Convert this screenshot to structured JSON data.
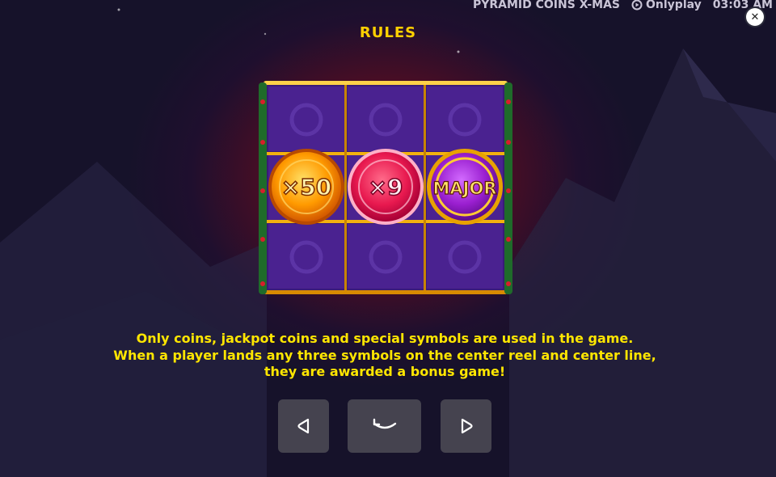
{
  "header": {
    "game_title": "PYRAMID COINS X-MAS",
    "brand": "Onlyplay",
    "clock": "03:03 AM",
    "close_icon": "close-icon"
  },
  "rules": {
    "title": "RULES",
    "coins": [
      {
        "label": "×50",
        "color": "#f7a000"
      },
      {
        "label": "×9",
        "color": "#e8194f"
      },
      {
        "label": "MAJOR",
        "color": "#9a1fd0"
      }
    ],
    "description": [
      "Only coins, jackpot coins and special symbols are used in the game.",
      "When a player lands any three symbols on the center reel and center line,",
      "they are awarded a bonus game!"
    ]
  },
  "navigation": {
    "prev_icon": "arrow-left-icon",
    "back_icon": "return-icon",
    "next_icon": "arrow-right-icon"
  },
  "colors": {
    "accent_yellow": "#ffd000",
    "button_bg": "#45434f",
    "reel_purple": "#4a2290"
  }
}
